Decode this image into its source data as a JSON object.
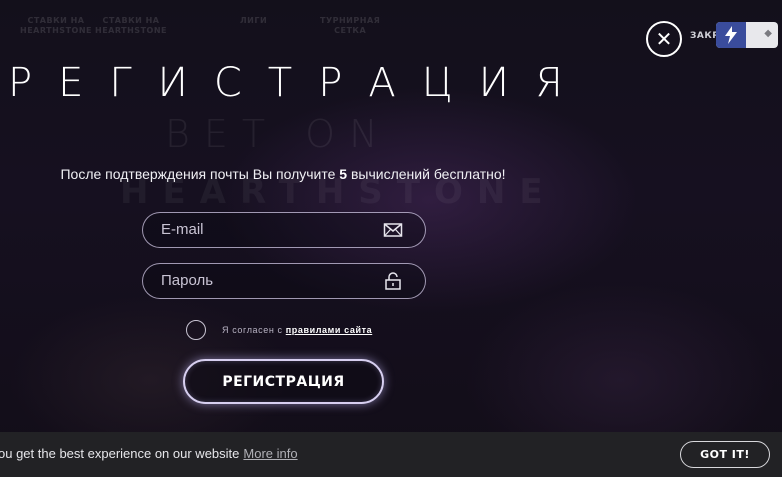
{
  "background": {
    "bet_text": "BET ON",
    "hs_text": "HEARTHSTONE"
  },
  "topnav": {
    "items": [
      "СТАВКИ НА\nHEARTHSTONE",
      "СТАВКИ НА\nHEARTHSTONE",
      "ЛИГИ",
      "ТУРНИРНАЯ\nСЕТКА"
    ]
  },
  "close": {
    "icon": "close-icon",
    "label": "ЗАКР"
  },
  "extension": {
    "icon": "lightning-bolt-icon",
    "color": "#3a4c9c"
  },
  "title": "РЕГИСТРАЦИЯ",
  "subtitle": {
    "before": "После подтверждения почты Вы получите ",
    "count": "5",
    "after": " вычислений бесплатно!"
  },
  "form": {
    "email_placeholder": "E-mail",
    "email_icon": "envelope-icon",
    "password_placeholder": "Пароль",
    "password_icon": "unlock-icon",
    "agree_text": "Я согласен с ",
    "agree_link": "правилами сайта",
    "submit_label": "РЕГИСТРАЦИЯ"
  },
  "cookie": {
    "text": "ou get the best experience on our website",
    "link": "More info",
    "button": "GOT IT!"
  },
  "colors": {
    "background": "#13101b",
    "cookie_bar": "#222225",
    "accent_glow": "#d7cff0"
  }
}
